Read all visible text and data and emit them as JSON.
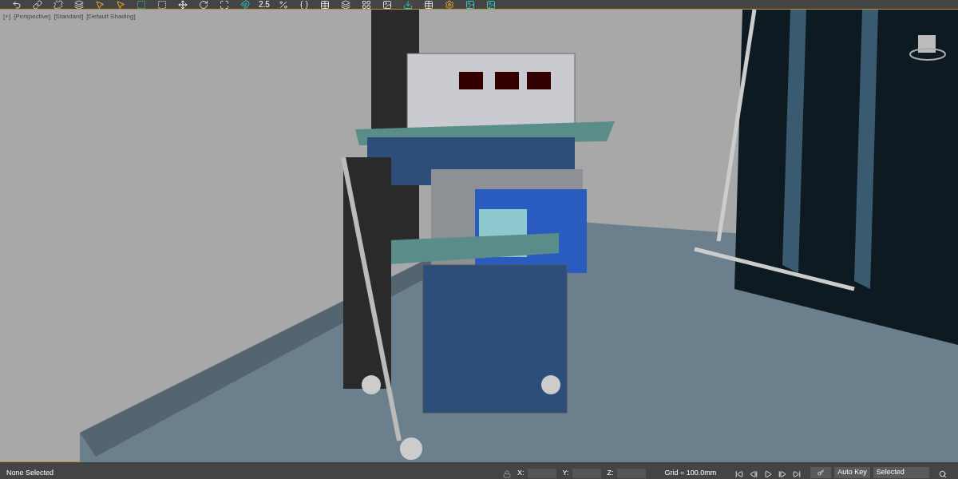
{
  "toolbar": {
    "snap_value": "2.5"
  },
  "viewport": {
    "labels": [
      "[+]",
      "[Perspective]",
      "[Standard]",
      "[Default Shading]"
    ]
  },
  "status_bar": {
    "selection": "None Selected",
    "coords": [
      {
        "axis": "X:"
      },
      {
        "axis": "Y:"
      },
      {
        "axis": "Z:"
      }
    ],
    "grid": "Grid = 100.0mm",
    "auto_key": "Auto Key",
    "key_filter": "Selected"
  }
}
